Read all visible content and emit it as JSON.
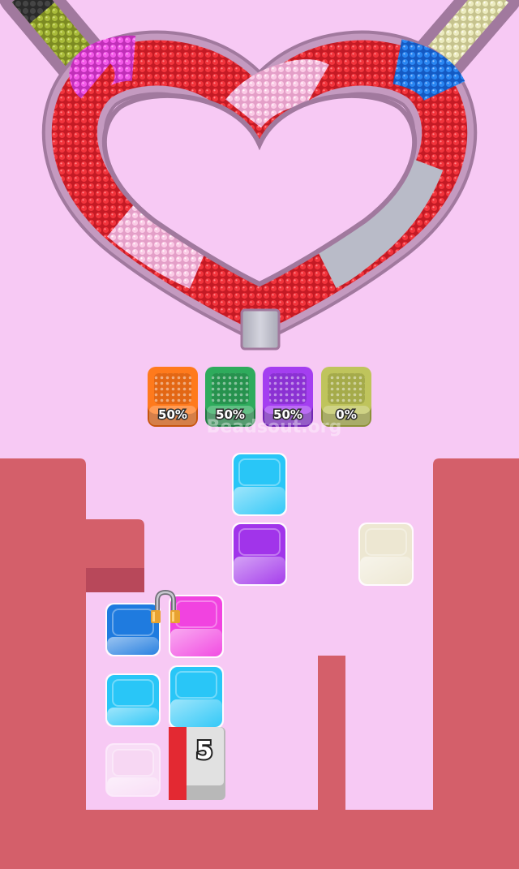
{
  "watermark": "Beadsout.org",
  "collectors": [
    {
      "color": "#ff7a1c",
      "dark": "#c7540c",
      "percent": "50%"
    },
    {
      "color": "#2eab5c",
      "dark": "#1e7a40",
      "percent": "50%"
    },
    {
      "color": "#a43ef0",
      "dark": "#7224b5",
      "percent": "50%"
    },
    {
      "color": "#bfc45c",
      "dark": "#8c9137",
      "percent": "0%"
    }
  ],
  "board_blocks": [
    {
      "name": "block-cyan-top",
      "color": "#29c6f7"
    },
    {
      "name": "block-purple",
      "color": "#a134ea"
    },
    {
      "name": "block-cream",
      "color": "#ede7d2"
    },
    {
      "name": "block-blue",
      "color": "#1f7bdf"
    },
    {
      "name": "block-magenta",
      "color": "#f143e0"
    },
    {
      "name": "block-cyan-left",
      "color": "#29c6f7"
    },
    {
      "name": "block-cyan-right",
      "color": "#29c6f7"
    },
    {
      "name": "block-empty-pink",
      "color": "#f7d7f3"
    }
  ],
  "counter_block": {
    "value": "5",
    "bar_color": "#e32932"
  },
  "heart_track_segments": [
    {
      "color": "#e9272d"
    },
    {
      "color": "#f9bde0"
    },
    {
      "color": "#1d7ef0"
    },
    {
      "color": "#b9bbc8"
    },
    {
      "color": "#f04fe6"
    }
  ],
  "colors": {
    "background": "#f7c9f4",
    "wall": "#d45f6a",
    "track_rim": "#a1799e"
  }
}
